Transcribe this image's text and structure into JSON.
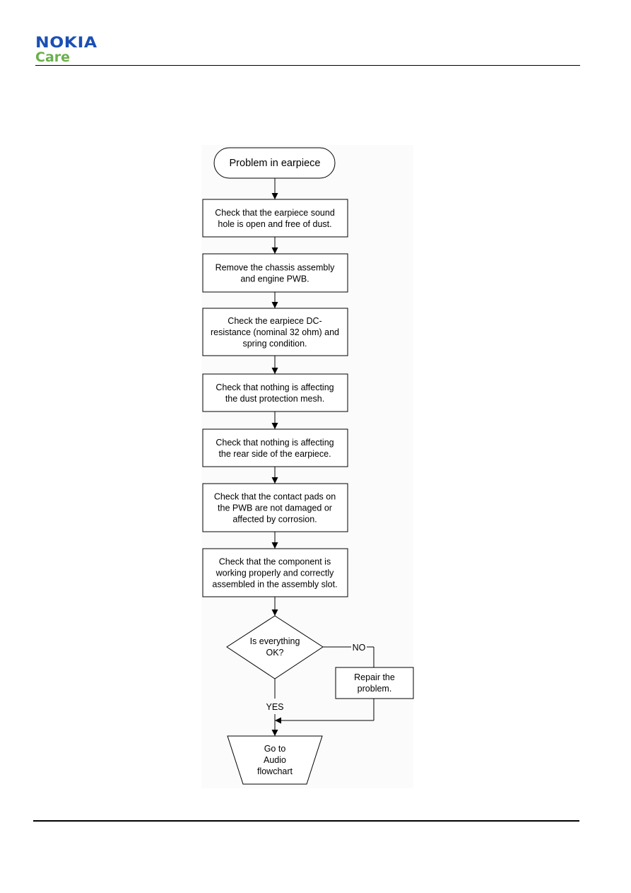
{
  "header": {
    "brand": "NOKIA",
    "sub_brand": "Care",
    "brand_color": "#1a50b4",
    "sub_brand_color": "#6ab04c"
  },
  "flowchart": {
    "start": "Problem in earpiece",
    "steps": [
      [
        "Check that the earpiece sound",
        "hole is open and free of dust."
      ],
      [
        "Remove the chassis assembly",
        "and engine PWB."
      ],
      [
        "Check the earpiece DC-",
        "resistance (nominal 32 ohm) and",
        "spring condition."
      ],
      [
        "Check that nothing is affecting",
        "the dust protection mesh."
      ],
      [
        "Check that nothing is affecting",
        "the rear side of the earpiece."
      ],
      [
        "Check that the contact pads on",
        "the PWB are not damaged or",
        "affected by corrosion."
      ],
      [
        "Check that the component is",
        "working properly and correctly",
        "assembled in the assembly slot."
      ]
    ],
    "decision": [
      "Is everything",
      "OK?"
    ],
    "no_label": "NO",
    "yes_label": "YES",
    "repair": [
      "Repair the",
      "problem."
    ],
    "end": [
      "Go to",
      "Audio",
      "flowchart"
    ]
  }
}
